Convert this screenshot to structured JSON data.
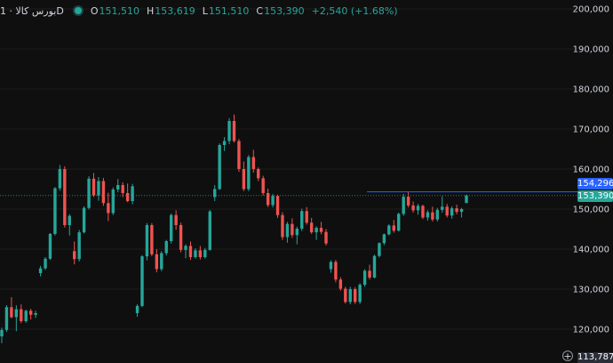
{
  "header": {
    "symbol": "بورس کالا · 1D",
    "o_label": "O",
    "o_value": "151,510",
    "h_label": "H",
    "h_value": "153,619",
    "l_label": "L",
    "l_value": "151,510",
    "c_label": "C",
    "c_value": "153,390",
    "change": "+2,540 (+1.68%)"
  },
  "price_tags": {
    "alert_line": "154,296",
    "last_price": "153,390",
    "crosshair_low": "113,787"
  },
  "colors": {
    "up": "#26a69a",
    "down": "#ef5350",
    "alert": "#2962ff",
    "last": "#26a69a",
    "background": "#0f0f0f"
  },
  "chart_data": {
    "type": "candlestick",
    "y_ticks": [
      "200,000",
      "190,000",
      "180,000",
      "170,000",
      "160,000",
      "150,000",
      "140,000",
      "130,000",
      "120,000"
    ],
    "y_tick_values": [
      200000,
      190000,
      180000,
      170000,
      160000,
      150000,
      140000,
      130000,
      120000
    ],
    "ylim": [
      113000,
      202000
    ],
    "alert_level": 154296,
    "last_price": 153390,
    "candles": [
      [
        118200,
        120400,
        116500,
        119800
      ],
      [
        119800,
        126000,
        119300,
        125500
      ],
      [
        125500,
        128000,
        122700,
        123000
      ],
      [
        123000,
        126000,
        119500,
        125000
      ],
      [
        125000,
        126200,
        121500,
        122000
      ],
      [
        122000,
        124900,
        121600,
        124600
      ],
      [
        124600,
        125100,
        122400,
        123600
      ],
      [
        123600,
        124600,
        122800,
        124000
      ],
      [
        134000,
        135800,
        133200,
        135200
      ],
      [
        135200,
        138000,
        134800,
        137600
      ],
      [
        137600,
        144000,
        137300,
        143800
      ],
      [
        143800,
        155500,
        143400,
        155200
      ],
      [
        155200,
        161000,
        154600,
        160000
      ],
      [
        160000,
        160700,
        145400,
        146000
      ],
      [
        146000,
        148700,
        143400,
        148300
      ],
      [
        139500,
        141900,
        136200,
        137500
      ],
      [
        137500,
        144800,
        136900,
        144200
      ],
      [
        144200,
        150700,
        143900,
        150300
      ],
      [
        150300,
        158200,
        149900,
        157600
      ],
      [
        157600,
        159000,
        153000,
        153400
      ],
      [
        153400,
        158000,
        152100,
        157000
      ],
      [
        157000,
        157800,
        150800,
        151500
      ],
      [
        151500,
        154100,
        147000,
        149000
      ],
      [
        149000,
        155400,
        148500,
        154900
      ],
      [
        154900,
        157500,
        154200,
        156000
      ],
      [
        156000,
        156700,
        153000,
        154000
      ],
      [
        154000,
        156400,
        151700,
        152000
      ],
      [
        152000,
        156300,
        151200,
        155700
      ],
      [
        124000,
        126200,
        123100,
        125800
      ],
      [
        125800,
        138500,
        125500,
        138200
      ],
      [
        138200,
        146500,
        137200,
        146000
      ],
      [
        146000,
        146500,
        138200,
        138700
      ],
      [
        138700,
        140000,
        134200,
        135000
      ],
      [
        135000,
        139500,
        134500,
        139000
      ],
      [
        139000,
        142300,
        138400,
        142000
      ],
      [
        142000,
        148900,
        141400,
        148500
      ],
      [
        148500,
        149700,
        144800,
        146000
      ],
      [
        146000,
        146600,
        139200,
        139800
      ],
      [
        139800,
        141200,
        137700,
        140800
      ],
      [
        140800,
        141900,
        137300,
        138000
      ],
      [
        138000,
        140200,
        137600,
        139700
      ],
      [
        139700,
        140800,
        137400,
        138000
      ],
      [
        138000,
        140300,
        137600,
        139800
      ],
      [
        139800,
        149800,
        139600,
        149400
      ],
      [
        153000,
        156000,
        152000,
        155000
      ],
      [
        155000,
        166400,
        154800,
        166000
      ],
      [
        166000,
        168000,
        164500,
        167000
      ],
      [
        167000,
        172700,
        166200,
        172000
      ],
      [
        172000,
        173600,
        166600,
        167000
      ],
      [
        167000,
        167500,
        159300,
        160000
      ],
      [
        160000,
        161900,
        154500,
        155000
      ],
      [
        155000,
        163500,
        154500,
        163000
      ],
      [
        163000,
        164800,
        159100,
        160000
      ],
      [
        160000,
        160400,
        157000,
        157700
      ],
      [
        157700,
        158300,
        153400,
        154000
      ],
      [
        154000,
        155100,
        150500,
        151000
      ],
      [
        151000,
        153800,
        150400,
        153300
      ],
      [
        153300,
        153600,
        147800,
        148500
      ],
      [
        148500,
        149200,
        142300,
        143000
      ],
      [
        143000,
        146800,
        141600,
        146300
      ],
      [
        146300,
        147700,
        142800,
        143500
      ],
      [
        143500,
        145600,
        141200,
        145100
      ],
      [
        145100,
        150100,
        144500,
        149500
      ],
      [
        149500,
        150500,
        146100,
        146600
      ],
      [
        146600,
        147800,
        143800,
        144200
      ],
      [
        144200,
        145700,
        142300,
        145300
      ],
      [
        145300,
        146800,
        143700,
        144300
      ],
      [
        144300,
        145000,
        140900,
        141400
      ],
      [
        135000,
        137200,
        134100,
        136800
      ],
      [
        136800,
        137300,
        131700,
        132400
      ],
      [
        132400,
        133000,
        129600,
        130100
      ],
      [
        130100,
        130600,
        126400,
        126800
      ],
      [
        126800,
        130600,
        126200,
        130000
      ],
      [
        130000,
        130500,
        126300,
        126800
      ],
      [
        126800,
        131500,
        126300,
        131100
      ],
      [
        131100,
        135000,
        130600,
        134600
      ],
      [
        134600,
        136100,
        132400,
        132900
      ],
      [
        132900,
        138600,
        132700,
        138300
      ],
      [
        138300,
        141700,
        137900,
        141500
      ],
      [
        141500,
        143900,
        141000,
        143700
      ],
      [
        143700,
        146200,
        143400,
        145900
      ],
      [
        145900,
        147300,
        144100,
        144600
      ],
      [
        144600,
        149100,
        144400,
        148800
      ],
      [
        148800,
        153800,
        148300,
        153100
      ],
      [
        153100,
        154200,
        150400,
        150900
      ],
      [
        150900,
        151900,
        149100,
        149700
      ],
      [
        149700,
        151300,
        148600,
        150800
      ],
      [
        150800,
        151100,
        147500,
        147900
      ],
      [
        147900,
        149700,
        147100,
        149200
      ],
      [
        149200,
        150600,
        146900,
        147400
      ],
      [
        147400,
        150300,
        146900,
        149800
      ],
      [
        149800,
        153200,
        149100,
        150600
      ],
      [
        150600,
        151300,
        147900,
        148400
      ],
      [
        148400,
        150700,
        147600,
        150200
      ],
      [
        150200,
        151100,
        148700,
        149300
      ],
      [
        149300,
        150300,
        147900,
        150000
      ],
      [
        151510,
        153619,
        151510,
        153390
      ]
    ]
  }
}
